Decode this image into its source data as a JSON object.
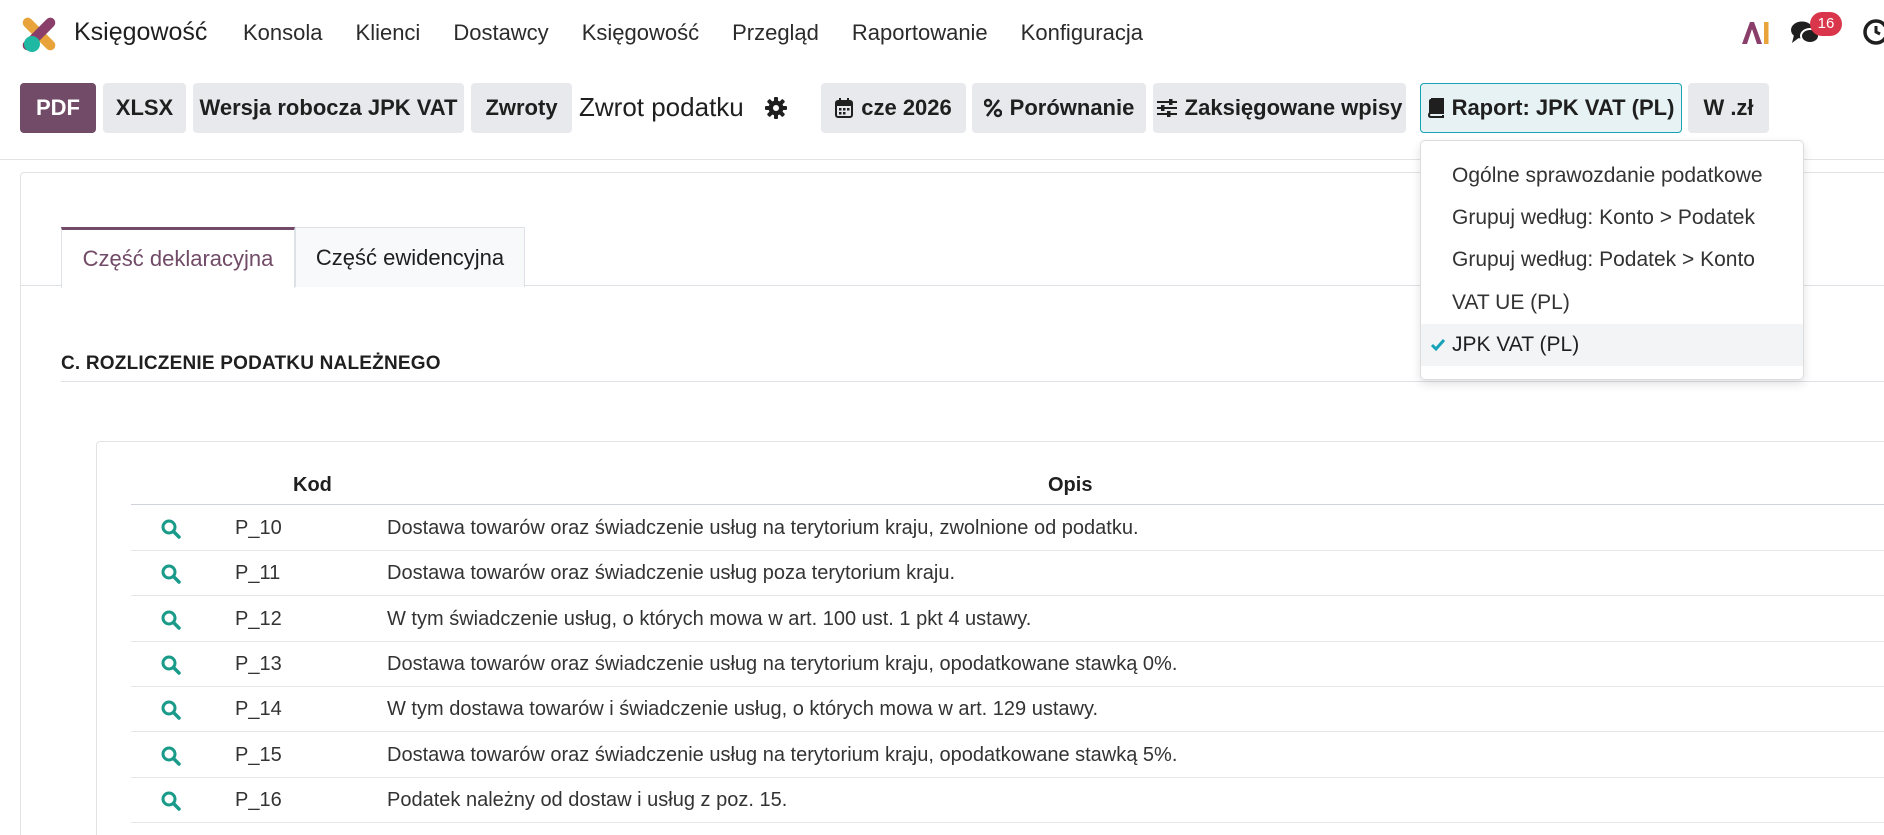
{
  "app": {
    "name": "Księgowość"
  },
  "nav": {
    "items": [
      "Konsola",
      "Klienci",
      "Dostawcy",
      "Księgowość",
      "Przegląd",
      "Raportowanie",
      "Konfiguracja"
    ],
    "notifications_count": "16"
  },
  "toolbar": {
    "pdf": "PDF",
    "xlsx": "XLSX",
    "draft": "Wersja robocza JPK VAT",
    "returns": "Zwroty",
    "title": "Zwrot podatku",
    "date_filter": "cze 2026",
    "comparison": "Porównanie",
    "posted": "Zaksięgowane wpisy",
    "report": "Raport: JPK VAT (PL)",
    "currency": "W .zł"
  },
  "report_menu": {
    "items": [
      "Ogólne sprawozdanie podatkowe",
      "Grupuj według: Konto > Podatek",
      "Grupuj według: Podatek > Konto",
      "VAT UE (PL)",
      "JPK VAT (PL)"
    ],
    "selected_index": 4
  },
  "tabs": [
    "Część deklaracyjna",
    "Część ewidencyjna"
  ],
  "section": {
    "title": "C. ROZLICZENIE PODATKU NALEŻNEGO"
  },
  "table": {
    "headers": {
      "code": "Kod",
      "description": "Opis"
    },
    "rows": [
      {
        "code": "P_10",
        "description": "Dostawa towarów oraz świadczenie usług na terytorium kraju, zwolnione od podatku."
      },
      {
        "code": "P_11",
        "description": "Dostawa towarów oraz świadczenie usług poza terytorium kraju."
      },
      {
        "code": "P_12",
        "description": "W tym świadczenie usług, o których mowa w art. 100 ust. 1 pkt 4 ustawy."
      },
      {
        "code": "P_13",
        "description": "Dostawa towarów oraz świadczenie usług na terytorium kraju, opodatkowane stawką 0%."
      },
      {
        "code": "P_14",
        "description": "W tym dostawa towarów i świadczenie usług, o których mowa w art. 129 ustawy."
      },
      {
        "code": "P_15",
        "description": "Dostawa towarów oraz świadczenie usług na terytorium kraju, opodatkowane stawką 5%."
      },
      {
        "code": "P_16",
        "description": "Podatek należny od dostaw i usług z poz. 15."
      }
    ]
  },
  "colors": {
    "brand": "#714b67",
    "accent": "#17a2b8",
    "badge": "#d9354b"
  },
  "icons": {
    "logo": "app-logo-icon",
    "ai": "ai-icon",
    "chat": "chat-icon",
    "clock": "clock-icon",
    "gear": "gear-icon",
    "calendar": "calendar-icon",
    "percent": "percent-icon",
    "sliders": "sliders-icon",
    "book": "book-icon",
    "check": "check-icon",
    "search": "search-icon"
  }
}
